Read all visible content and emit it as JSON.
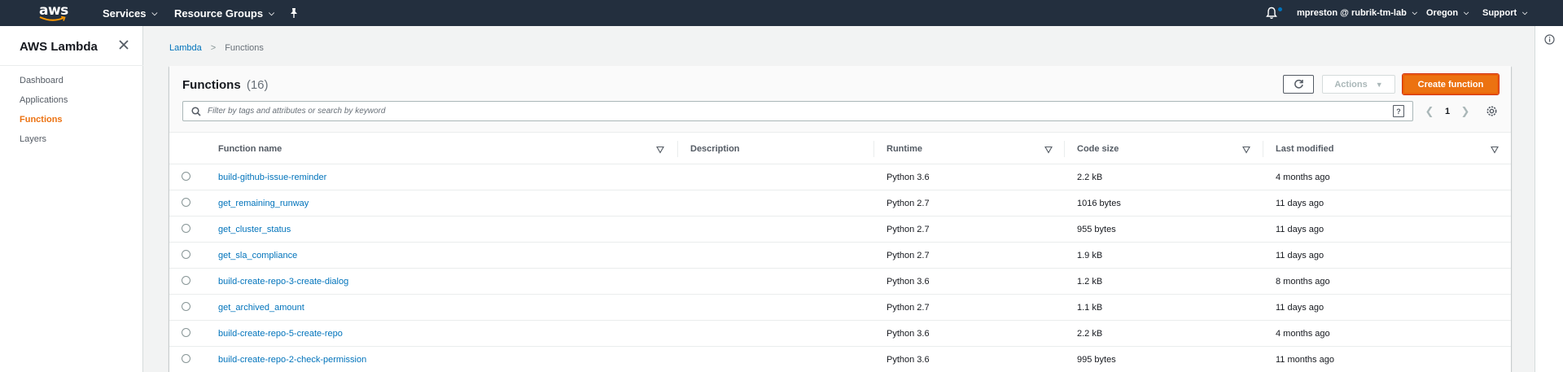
{
  "topnav": {
    "logo_text": "aws",
    "services_label": "Services",
    "resource_groups_label": "Resource Groups",
    "account_label": "mpreston @ rubrik-tm-lab",
    "region_label": "Oregon",
    "support_label": "Support",
    "bell_dot_color": "#0073bb"
  },
  "sidebar": {
    "title": "AWS Lambda",
    "items": [
      {
        "label": "Dashboard",
        "active": false
      },
      {
        "label": "Applications",
        "active": false
      },
      {
        "label": "Functions",
        "active": true
      },
      {
        "label": "Layers",
        "active": false
      }
    ]
  },
  "breadcrumb": {
    "root": "Lambda",
    "current": "Functions"
  },
  "panel": {
    "title": "Functions",
    "count": "(16)",
    "actions_label": "Actions",
    "create_label": "Create function",
    "search_placeholder": "Filter by tags and attributes or search by keyword",
    "help_label": "?",
    "page_number": "1"
  },
  "table": {
    "columns": [
      "Function name",
      "Description",
      "Runtime",
      "Code size",
      "Last modified"
    ],
    "rows": [
      {
        "name": "build-github-issue-reminder",
        "description": "",
        "runtime": "Python 3.6",
        "size": "2.2 kB",
        "modified": "4 months ago"
      },
      {
        "name": "get_remaining_runway",
        "description": "",
        "runtime": "Python 2.7",
        "size": "1016 bytes",
        "modified": "11 days ago"
      },
      {
        "name": "get_cluster_status",
        "description": "",
        "runtime": "Python 2.7",
        "size": "955 bytes",
        "modified": "11 days ago"
      },
      {
        "name": "get_sla_compliance",
        "description": "",
        "runtime": "Python 2.7",
        "size": "1.9 kB",
        "modified": "11 days ago"
      },
      {
        "name": "build-create-repo-3-create-dialog",
        "description": "",
        "runtime": "Python 3.6",
        "size": "1.2 kB",
        "modified": "8 months ago"
      },
      {
        "name": "get_archived_amount",
        "description": "",
        "runtime": "Python 2.7",
        "size": "1.1 kB",
        "modified": "11 days ago"
      },
      {
        "name": "build-create-repo-5-create-repo",
        "description": "",
        "runtime": "Python 3.6",
        "size": "2.2 kB",
        "modified": "4 months ago"
      },
      {
        "name": "build-create-repo-2-check-permission",
        "description": "",
        "runtime": "Python 3.6",
        "size": "995 bytes",
        "modified": "11 months ago"
      }
    ]
  },
  "colors": {
    "nav_bg": "#232f3e",
    "accent_orange": "#ec7211",
    "link_blue": "#0073bb"
  }
}
